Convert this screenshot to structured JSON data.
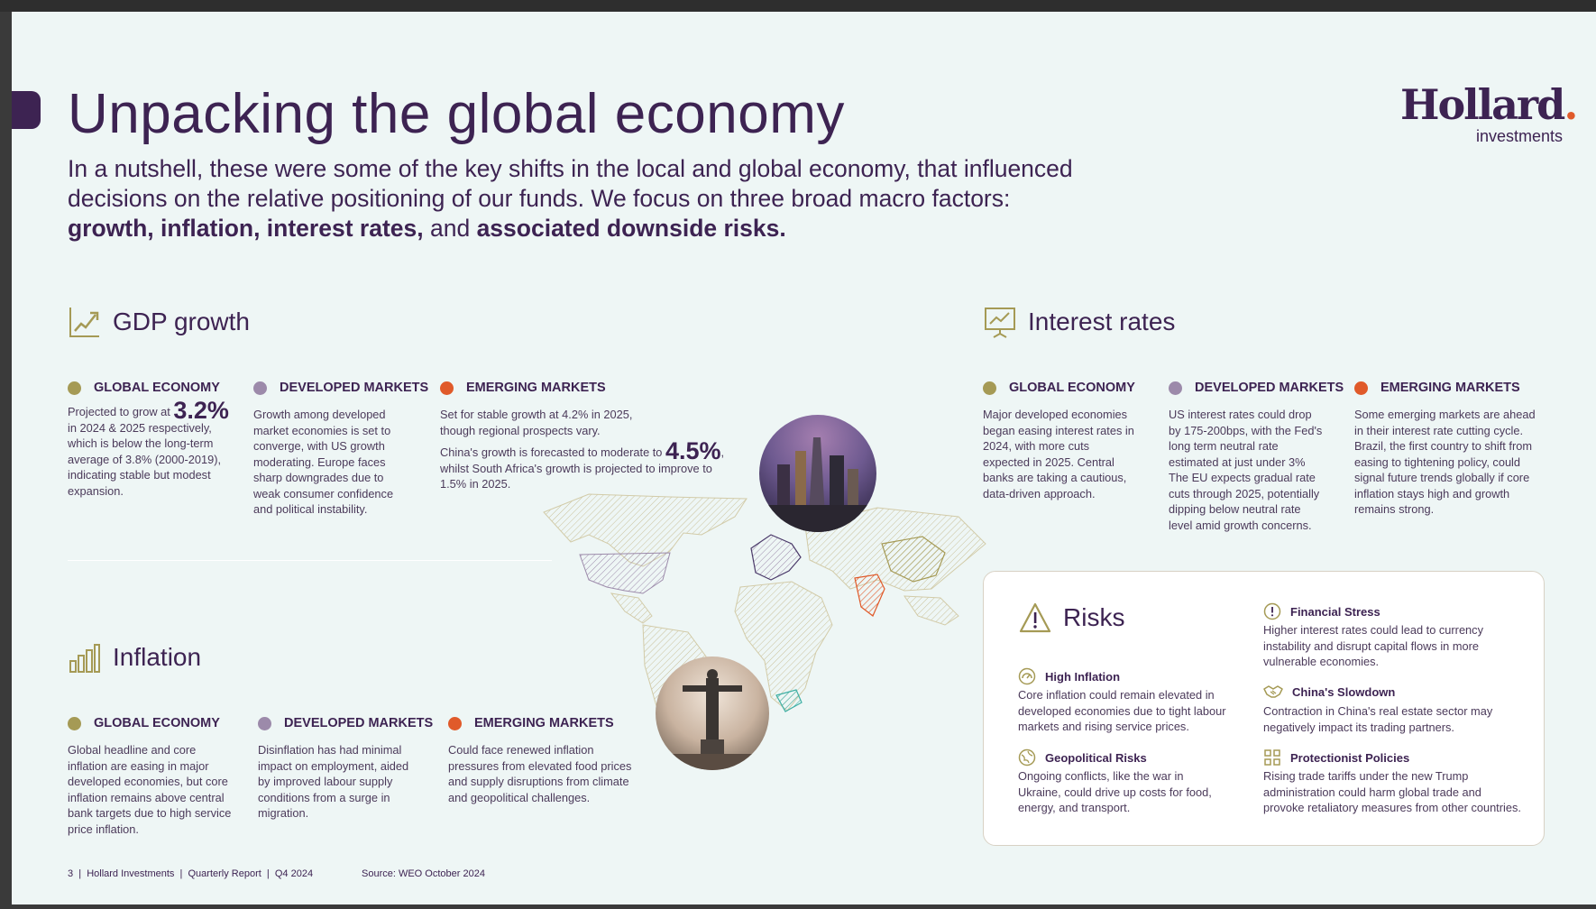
{
  "title": "Unpacking the global economy",
  "intro": {
    "line1": "In a nutshell, these were some of the key shifts in the local and global economy, that influenced",
    "line2": "decisions on the relative positioning of our funds. We focus on three broad macro factors:",
    "bold1": "growth, inflation, interest rates,",
    "and": " and ",
    "bold2": "associated downside risks."
  },
  "logo": {
    "word": "Hollard",
    "dot": ".",
    "sub": "investments"
  },
  "colors": {
    "gold": "#a59a55",
    "lilac": "#9c8aaa",
    "orange": "#e05a2a",
    "purple": "#3d2352"
  },
  "gdp": {
    "heading": "GDP growth",
    "icon": "growth-chart-icon",
    "global": {
      "label": "GLOBAL ECONOMY",
      "pre": "Projected to grow at ",
      "big": "3.2%",
      "post": "in 2024 & 2025 respectively, which is below the long-term average of 3.8% (2000-2019), indicating stable but modest expansion."
    },
    "developed": {
      "label": "DEVELOPED MARKETS",
      "text": "Growth among developed market economies is set to converge, with US growth moderating. Europe faces sharp downgrades due to weak consumer confidence and political instability."
    },
    "emerging": {
      "label": "EMERGING MARKETS",
      "text1": "Set for stable growth at 4.2% in 2025, though regional prospects vary.",
      "pre": "China's growth is forecasted to moderate to ",
      "big": "4.5%",
      "post": ", whilst South Africa's growth is projected to improve to 1.5% in 2025."
    }
  },
  "inflation": {
    "heading": "Inflation",
    "icon": "bar-chart-icon",
    "global": {
      "label": "GLOBAL ECONOMY",
      "text": "Global headline and core inflation are easing in major developed economies, but core inflation remains above central bank targets due to high service price inflation."
    },
    "developed": {
      "label": "DEVELOPED MARKETS",
      "text": "Disinflation has had minimal impact on employment, aided by improved labour supply conditions from a surge in migration."
    },
    "emerging": {
      "label": "EMERGING MARKETS",
      "text": "Could face renewed inflation pressures from elevated food prices and supply disruptions from climate and geopolitical challenges."
    }
  },
  "interest": {
    "heading": "Interest rates",
    "icon": "presentation-chart-icon",
    "global": {
      "label": "GLOBAL ECONOMY",
      "text": "Major developed economies began easing interest rates in 2024, with more cuts expected in 2025. Central banks are taking a cautious, data-driven approach."
    },
    "developed": {
      "label": "DEVELOPED MARKETS",
      "text1": "US interest rates could drop by 175-200bps, with the Fed's long term neutral rate estimated at just under 3%",
      "text2": "The EU expects gradual rate cuts through 2025, potentially dipping below neutral rate level amid growth concerns."
    },
    "emerging": {
      "label": "EMERGING MARKETS",
      "text": "Some emerging markets are ahead in their interest rate cutting cycle. Brazil, the first country to shift from easing to tightening policy, could signal future trends globally if core inflation stays high and growth remains strong."
    }
  },
  "risks": {
    "heading": "Risks",
    "items": [
      {
        "title": "High Inflation",
        "icon": "inflation-gauge-icon",
        "text": "Core inflation could remain elevated in developed economies due to tight labour markets and rising service prices."
      },
      {
        "title": "Geopolitical Risks",
        "icon": "globe-icon",
        "text": "Ongoing conflicts, like the war in Ukraine, could drive up costs for food, energy, and transport."
      },
      {
        "title": "Financial Stress",
        "icon": "alert-circle-icon",
        "text": "Higher interest rates could lead to currency instability and disrupt capital flows in more vulnerable economies."
      },
      {
        "title": "China's Slowdown",
        "icon": "handshake-icon",
        "text": "Contraction in China's real estate sector may negatively impact its trading partners."
      },
      {
        "title": "Protectionist Policies",
        "icon": "tariff-blocks-icon",
        "text": "Rising trade tariffs under the new Trump administration could harm global trade and provoke retaliatory measures from other countries."
      }
    ]
  },
  "footer": {
    "text": "3  |  Hollard Investments  |  Quarterly Report  |  Q4 2024",
    "source": "Source: WEO October 2024"
  }
}
